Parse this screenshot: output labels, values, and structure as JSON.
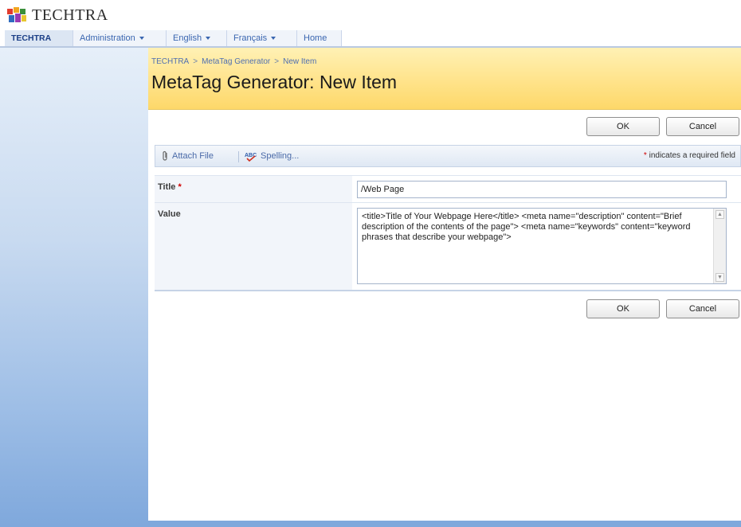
{
  "brand": {
    "name": "TECHTRA",
    "logo_icon": "techtra-logo-icon"
  },
  "nav": {
    "tabs": [
      {
        "label": "TECHTRA",
        "active": true,
        "has_menu": false
      },
      {
        "label": "Administration",
        "active": false,
        "has_menu": true
      },
      {
        "label": "English",
        "active": false,
        "has_menu": true
      },
      {
        "label": "Français",
        "active": false,
        "has_menu": true
      },
      {
        "label": "Home",
        "active": false,
        "has_menu": false
      }
    ]
  },
  "breadcrumb": {
    "items": [
      "TECHTRA",
      "MetaTag Generator",
      "New Item"
    ],
    "separator": ">"
  },
  "page_title": "MetaTag Generator: New Item",
  "buttons": {
    "ok": "OK",
    "cancel": "Cancel"
  },
  "toolbar": {
    "attach_file": "Attach File",
    "spelling": "Spelling...",
    "required_star": "*",
    "required_note": "indicates a required field"
  },
  "form": {
    "title_label": "Title",
    "title_required": "*",
    "title_value": "/Web Page",
    "value_label": "Value",
    "value_text": "<title>Title of Your Webpage Here</title> <meta name=\"description\" content=\"Brief description of the contents of the page\"> <meta name=\"keywords\" content=\"keyword phrases that describe your webpage\">"
  },
  "colors": {
    "title_band": "#ffe38a",
    "link": "#4f6fb0",
    "required": "#d00000",
    "sidebar": "#9ebee6"
  }
}
